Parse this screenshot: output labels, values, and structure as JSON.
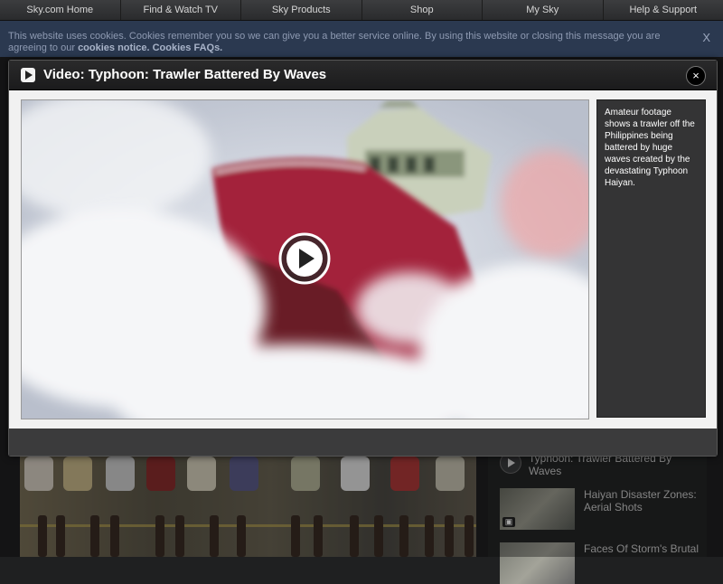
{
  "nav": {
    "items": [
      "Sky.com Home",
      "Find & Watch TV",
      "Sky Products",
      "Shop",
      "My Sky",
      "Help & Support"
    ]
  },
  "cookie_bar": {
    "text": "This website uses cookies. Cookies remember you so we can give you a better service online. By using this website or closing this message you are agreeing to our",
    "notice_link": "cookies notice.",
    "faq_link": "Cookies FAQs.",
    "close_label": "X"
  },
  "modal": {
    "icon": "play-icon",
    "title": "Video: Typhoon: Trawler Battered By Waves",
    "close_label": "×",
    "description": "Amateur footage shows a trawler off the Philippines being battered by huge waves created by the devastating Typhoon Haiyan."
  },
  "related": {
    "items": [
      {
        "title": "Typhoon: Trawler Battered By Waves"
      },
      {
        "title": "Haiyan Disaster Zones: Aerial Shots"
      },
      {
        "title": "Faces Of Storm's Brutal"
      }
    ]
  },
  "colors": {
    "cookie_bg": "#2b3950",
    "modal_bg": "#3b3b3c",
    "ship_hull": "#a3243a"
  }
}
